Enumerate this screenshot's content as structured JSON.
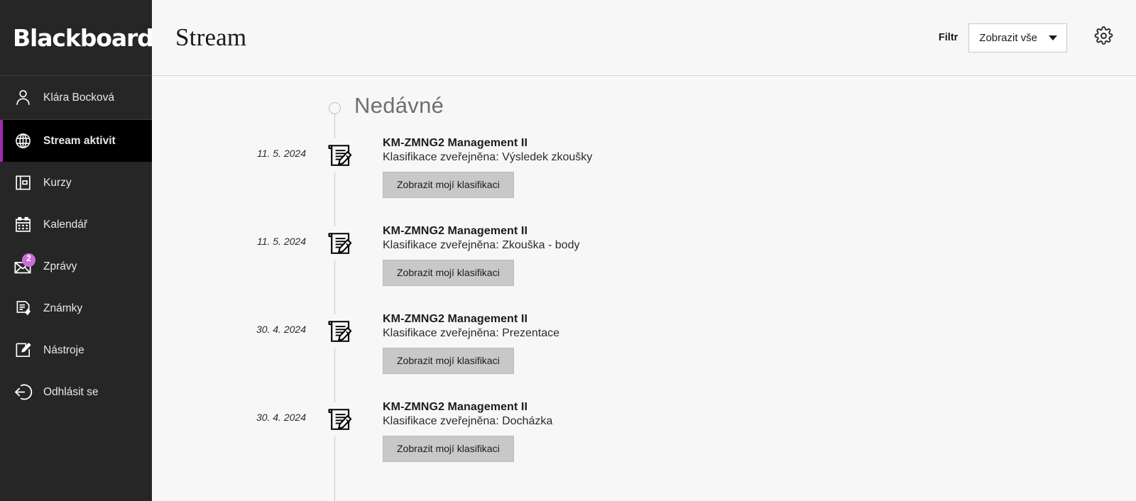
{
  "sidebar": {
    "brand": {
      "name": "Blackboard",
      "trademark": "®"
    },
    "items": [
      {
        "label": "Klára Bocková",
        "icon": "user-icon",
        "active": false,
        "badge": null
      },
      {
        "label": "Stream aktivit",
        "icon": "globe-icon",
        "active": true,
        "badge": null
      },
      {
        "label": "Kurzy",
        "icon": "courses-book-icon",
        "active": false,
        "badge": null
      },
      {
        "label": "Kalendář",
        "icon": "calendar-icon",
        "active": false,
        "badge": null
      },
      {
        "label": "Zprávy",
        "icon": "envelope-icon",
        "active": false,
        "badge": "2"
      },
      {
        "label": "Známky",
        "icon": "grades-document-icon",
        "active": false,
        "badge": null
      },
      {
        "label": "Nástroje",
        "icon": "tools-edit-icon",
        "active": false,
        "badge": null
      },
      {
        "label": "Odhlásit se",
        "icon": "logout-icon",
        "active": false,
        "badge": null
      }
    ]
  },
  "header": {
    "title": "Stream",
    "filter_label": "Filtr",
    "filter_value": "Zobrazit vše",
    "filter_caret_icon": "chevron-down-icon",
    "settings_icon": "gear-icon"
  },
  "stream": {
    "section_heading": "Nedávné",
    "items": [
      {
        "date": "11. 5. 2024",
        "course": "KM-ZMNG2 Management II",
        "description": "Klasifikace zveřejněna: Výsledek zkoušky",
        "button_label": "Zobrazit mojí klasifikaci",
        "icon": "document-pencil-icon"
      },
      {
        "date": "11. 5. 2024",
        "course": "KM-ZMNG2 Management II",
        "description": "Klasifikace zveřejněna: Zkouška - body",
        "button_label": "Zobrazit mojí klasifikaci",
        "icon": "document-pencil-icon"
      },
      {
        "date": "30. 4. 2024",
        "course": "KM-ZMNG2 Management II",
        "description": "Klasifikace zveřejněna: Prezentace",
        "button_label": "Zobrazit mojí klasifikaci",
        "icon": "document-pencil-icon"
      },
      {
        "date": "30. 4. 2024",
        "course": "KM-ZMNG2 Management II",
        "description": "Klasifikace zveřejněna: Docházka",
        "button_label": "Zobrazit mojí klasifikaci",
        "icon": "document-pencil-icon"
      }
    ]
  },
  "colors": {
    "sidebar_bg": "#262626",
    "sidebar_active_bg": "#000000",
    "accent_purple": "#a12aaf",
    "badge_purple": "#cc6ddb",
    "main_bg": "#f7f7f7",
    "button_gray": "#c8c8c8"
  }
}
